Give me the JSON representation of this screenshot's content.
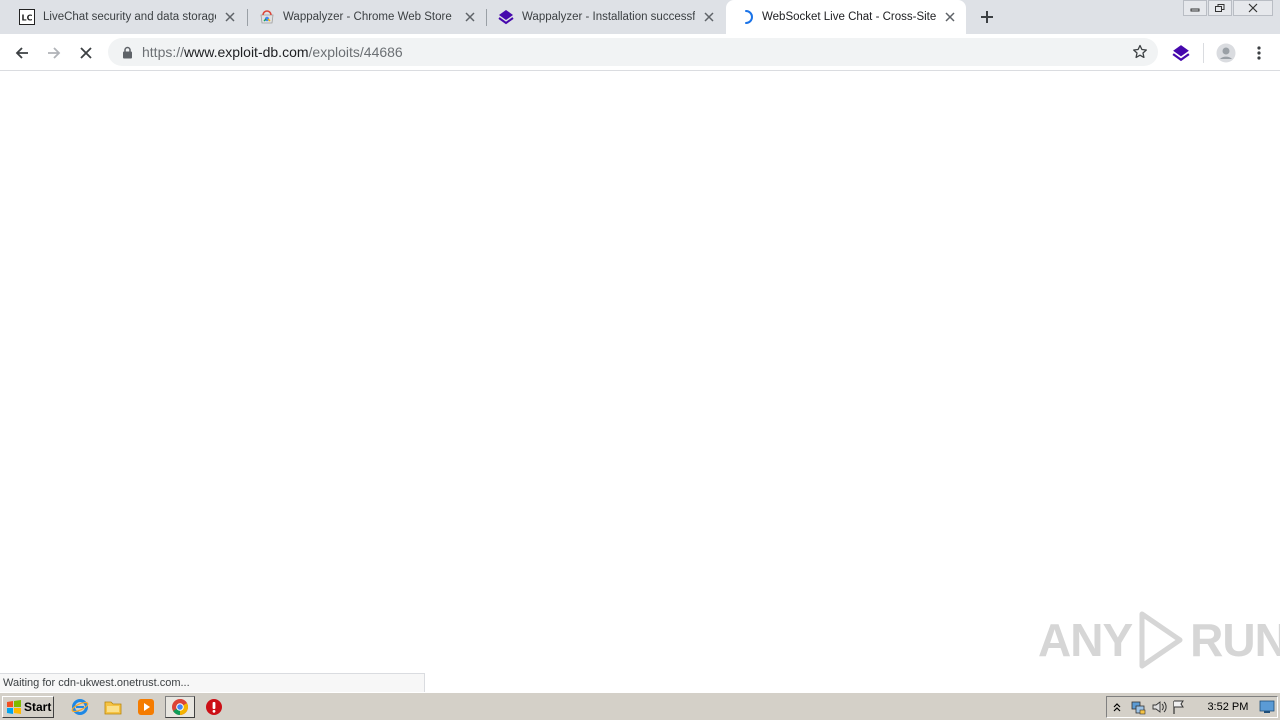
{
  "browser": {
    "tabs": [
      {
        "title": "LiveChat security and data storage |",
        "favicon": "livechat-logo-icon",
        "favicon_text": "LC",
        "active": false
      },
      {
        "title": "Wappalyzer - Chrome Web Store",
        "favicon": "chrome-web-store-icon",
        "active": false
      },
      {
        "title": "Wappalyzer - Installation successful",
        "favicon": "wappalyzer-icon",
        "active": false
      },
      {
        "title": "WebSocket Live Chat - Cross-Site Sc",
        "favicon": "loading-spinner-icon",
        "active": true
      }
    ],
    "url": {
      "scheme": "https://",
      "host": "www.exploit-db.com",
      "path": "/exploits/44686"
    }
  },
  "status": {
    "text": "Waiting for cdn-ukwest.onetrust.com..."
  },
  "watermark": {
    "left": "ANY",
    "right": "RUN"
  },
  "taskbar": {
    "start_label": "Start",
    "clock": "3:52 PM"
  },
  "colors": {
    "tabstrip": "#dee1e6",
    "wappalyzer": "#4608ad",
    "spinner": "#1a73e8",
    "taskbar": "#d4d0c8",
    "opera_red": "#cc0f16"
  }
}
